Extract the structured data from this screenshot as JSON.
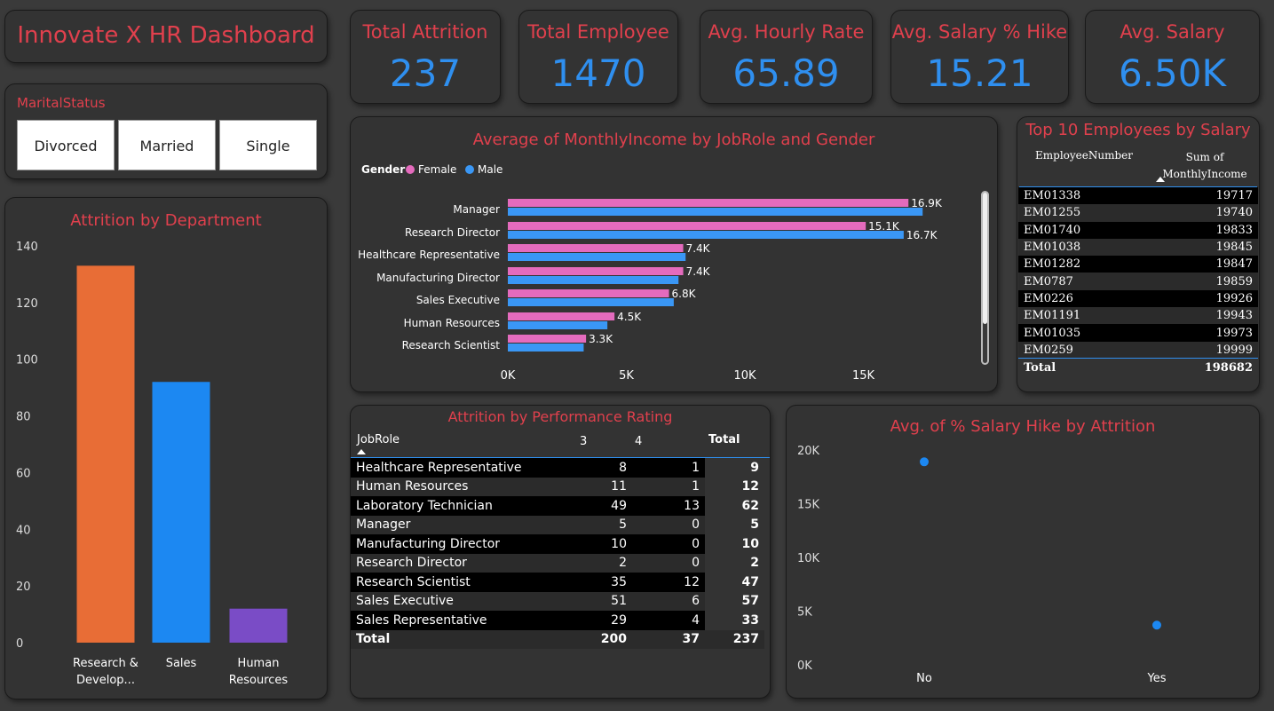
{
  "dashboard": {
    "title": "Innovate X HR Dashboard"
  },
  "kpis": [
    {
      "label": "Total Attrition",
      "value": "237"
    },
    {
      "label": "Total Employee",
      "value": "1470"
    },
    {
      "label": "Avg. Hourly Rate",
      "value": "65.89"
    },
    {
      "label": "Avg. Salary % Hike",
      "value": "15.21"
    },
    {
      "label": "Avg. Salary",
      "value": "6.50K"
    }
  ],
  "slicer": {
    "title": "MaritalStatus",
    "options": [
      "Divorced",
      "Married",
      "Single"
    ]
  },
  "colors": {
    "accent_red": "#e0404d",
    "kpi_blue": "#2f8fef",
    "female": "#e46bbd",
    "male": "#3a97f5",
    "rd": "#e86d36",
    "sales": "#1c88f2",
    "hr": "#7a4cc6"
  },
  "chart_data": [
    {
      "type": "bar",
      "title": "Attrition by Department",
      "categories": [
        "Research & Develop...",
        "Sales",
        "Human Resources"
      ],
      "category_lines": [
        [
          "Research &",
          "Develop..."
        ],
        [
          "Sales"
        ],
        [
          "Human",
          "Resources"
        ]
      ],
      "values": [
        133,
        92,
        12
      ],
      "ylim": [
        0,
        140
      ],
      "yticks": [
        "0",
        "20",
        "40",
        "60",
        "80",
        "100",
        "120",
        "140"
      ],
      "grid": false
    },
    {
      "type": "bar",
      "orientation": "horizontal",
      "title": "Average of MonthlyIncome by JobRole and Gender",
      "legend_title": "Gender",
      "categories": [
        "Manager",
        "Research Director",
        "Healthcare Representative",
        "Manufacturing Director",
        "Sales Executive",
        "Human Resources",
        "Research Scientist"
      ],
      "series": [
        {
          "name": "Female",
          "values": [
            16900,
            15100,
            7400,
            7400,
            6800,
            4500,
            3300
          ],
          "labels": [
            "16.9K",
            "15.1K",
            "7.4K",
            "7.4K",
            "6.8K",
            "4.5K",
            "3.3K"
          ]
        },
        {
          "name": "Male",
          "values": [
            17500,
            16700,
            7500,
            7200,
            7000,
            4200,
            3200
          ],
          "labels": [
            "",
            "16.7K",
            "",
            "",
            "",
            "",
            ""
          ]
        }
      ],
      "xticks": [
        "0K",
        "5K",
        "10K",
        "15K"
      ],
      "xlim": [
        0,
        19000
      ],
      "legend_position": "top-left"
    },
    {
      "type": "scatter",
      "title": "Avg. of % Salary Hike by Attrition",
      "categories": [
        "No",
        "Yes"
      ],
      "values": [
        18900,
        3700
      ],
      "ylim": [
        0,
        20000
      ],
      "yticks": [
        "0K",
        "5K",
        "10K",
        "15K",
        "20K"
      ]
    }
  ],
  "top10": {
    "title": "Top 10 Employees by Salary",
    "headers": [
      "EmployeeNumber",
      "Sum of",
      "MonthlyIncome"
    ],
    "rows": [
      [
        "EM01338",
        "19717"
      ],
      [
        "EM01255",
        "19740"
      ],
      [
        "EM01740",
        "19833"
      ],
      [
        "EM01038",
        "19845"
      ],
      [
        "EM01282",
        "19847"
      ],
      [
        "EM0787",
        "19859"
      ],
      [
        "EM0226",
        "19926"
      ],
      [
        "EM01191",
        "19943"
      ],
      [
        "EM01035",
        "19973"
      ],
      [
        "EM0259",
        "19999"
      ]
    ],
    "total": [
      "Total",
      "198682"
    ]
  },
  "perf": {
    "title": "Attrition by Performance Rating",
    "headers": [
      "JobRole",
      "3",
      "4",
      "Total"
    ],
    "rows": [
      [
        "Healthcare Representative",
        "8",
        "1",
        "9"
      ],
      [
        "Human Resources",
        "11",
        "1",
        "12"
      ],
      [
        "Laboratory Technician",
        "49",
        "13",
        "62"
      ],
      [
        "Manager",
        "5",
        "0",
        "5"
      ],
      [
        "Manufacturing Director",
        "10",
        "0",
        "10"
      ],
      [
        "Research Director",
        "2",
        "0",
        "2"
      ],
      [
        "Research Scientist",
        "35",
        "12",
        "47"
      ],
      [
        "Sales Executive",
        "51",
        "6",
        "57"
      ],
      [
        "Sales Representative",
        "29",
        "4",
        "33"
      ]
    ],
    "total": [
      "Total",
      "200",
      "37",
      "237"
    ]
  }
}
